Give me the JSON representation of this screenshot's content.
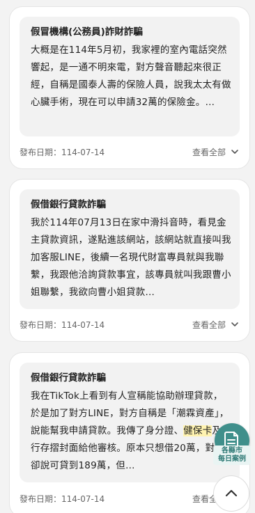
{
  "cards": [
    {
      "title": "假冒機構(公務員)詐財詐騙",
      "text": "大概是在114年5月初，我家裡的室內電話突然響起，是一通不明來電，對方聲音聽起來很正經，自稱是國泰人壽的保險人員，說我太太有做心臟手術，現在可以申請32萬的保險金。…",
      "date": "發布日期：114-07-14",
      "expand_label": "查看全部"
    },
    {
      "title": "假借銀行貸款詐騙",
      "text": "我於114年07月13日在家中滑抖音時，看見金主貸款資訊，遂點進該網站，該網站就直接叫我加客服LINE，後續一名現代財富專員就與我聯繫，我跟他洽詢貸款事宜，該專員就叫我跟曹小姐聯繫，我欲向曹小姐貸款…",
      "date": "發布日期：114-07-14",
      "expand_label": "查看全部"
    },
    {
      "title": "假借銀行貸款詐騙",
      "text_before": "我在TikTok上看到有人宣稱能協助辦理貸款，於是加了對方LINE，對方自稱是「潮霖資產」，說能幫我申請貸款。我傳了身分證、",
      "text_highlight": "健保卡",
      "text_after": "及銀行存摺封面給他審核。原本只想借20萬，對方卻說可貸到189萬，但…",
      "date": "發布日期：114-07-14",
      "expand_label": "查看全部"
    }
  ],
  "fab": {
    "cases_label_line1": "各縣市",
    "cases_label_line2": "每日案例",
    "cases_icon": "document-icon",
    "top_icon": "chevron-up-icon"
  },
  "colors": {
    "background": "#f3f3f3",
    "card": "#ffffff",
    "card_body": "#f2f2f2",
    "accent_teal": "#3f8f8b",
    "highlight": "#fff3b0"
  }
}
